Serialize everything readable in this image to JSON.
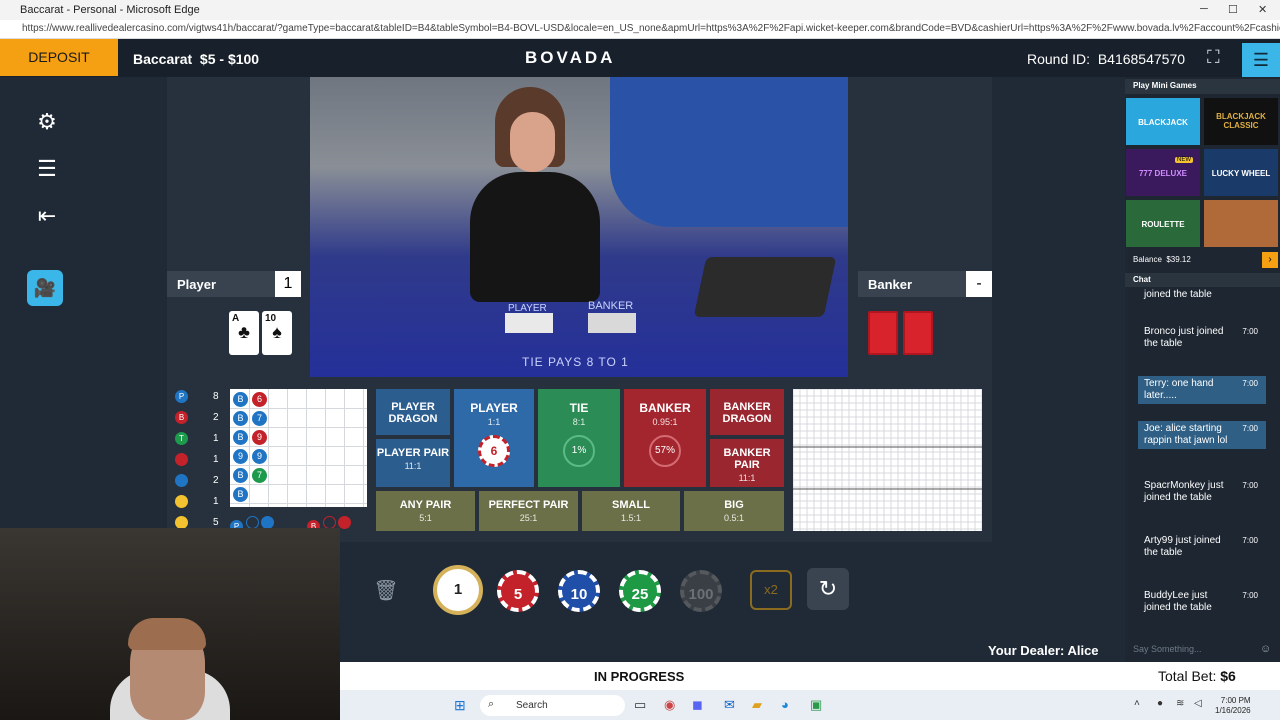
{
  "browser": {
    "title": "Baccarat - Personal - Microsoft Edge",
    "url": "https://www.reallivedealercasino.com/vigtws41h/baccarat/?gameType=baccarat&tableID=B4&tableSymbol=B4-BOVL-USD&locale=en_US_none&apmUrl=https%3A%2F%2Fapi.wicket-keeper.com&brandCode=BVD&cashierUrl=https%3A%2F%2Fwww.bovada.lv%2Faccount%2Fcashier%2Fdeposit&ho...",
    "min": "─",
    "max": "☐",
    "close": "✕"
  },
  "header": {
    "deposit": "DEPOSIT",
    "table_name": "Baccarat  $5 - $100",
    "brand": "BOVADA",
    "round_id": "Round ID:  B4168547570"
  },
  "sidebar": {
    "settings_icon": "⚙",
    "history_icon": "☰",
    "exit_icon": "⇤",
    "camera_icon": "🎥"
  },
  "hands": {
    "player_label": "Player",
    "player_score": "1",
    "banker_label": "Banker",
    "banker_score": "-",
    "player_cards": [
      {
        "rank": "A",
        "suit": "♣"
      },
      {
        "rank": "10",
        "suit": "♠"
      }
    ]
  },
  "video_overlay": {
    "player_word": "PLAYER",
    "banker_word": "BANKER",
    "tie_text": "TIE PAYS 8 TO 1"
  },
  "stats": [
    {
      "code": "P",
      "color": "#1f75c4",
      "count": "8"
    },
    {
      "code": "B",
      "color": "#c4222a",
      "count": "2"
    },
    {
      "code": "T",
      "color": "#1d9a4b",
      "count": "1"
    },
    {
      "code": "",
      "color": "#c4222a",
      "count": "1"
    },
    {
      "code": "",
      "color": "#1f75c4",
      "count": "2"
    },
    {
      "code": "",
      "color": "#f2c230",
      "count": "1"
    },
    {
      "code": "",
      "color": "#f2c230",
      "count": "5"
    }
  ],
  "bead_road": {
    "col1": [
      "B",
      "B",
      "B",
      "9",
      "B",
      "B"
    ],
    "col2": [
      "6",
      "7",
      "9",
      "9",
      "7"
    ]
  },
  "ask": {
    "p": "P",
    "b": "B"
  },
  "bets": {
    "player_dragon": "PLAYER DRAGON",
    "player_pair": "PLAYER PAIR",
    "player_pair_odds": "11:1",
    "player": "PLAYER",
    "player_odds": "1:1",
    "player_chip": "6",
    "tie": "TIE",
    "tie_odds": "8:1",
    "tie_pct": "1%",
    "banker": "BANKER",
    "banker_odds": "0.95:1",
    "banker_pct": "57%",
    "banker_dragon": "BANKER DRAGON",
    "banker_pair": "BANKER PAIR",
    "banker_pair_odds": "11:1",
    "any_pair": "ANY PAIR",
    "any_pair_odds": "5:1",
    "perfect_pair": "PERFECT PAIR",
    "perfect_pair_odds": "25:1",
    "small": "SMALL",
    "small_odds": "1.5:1",
    "big": "BIG",
    "big_odds": "0.5:1"
  },
  "chips": [
    "1",
    "5",
    "10",
    "25",
    "100"
  ],
  "controls": {
    "undo_icon": "🗑",
    "double": "x2",
    "repeat_icon": "↻"
  },
  "dealer": "Your Dealer: Alice",
  "status": "IN PROGRESS",
  "total_bet_label": "Total Bet:",
  "total_bet": "$6",
  "mini_games": {
    "title": "Play Mini Games",
    "games": [
      "BLACKJACK",
      "BLACKJACK CLASSIC",
      "777 DELUXE",
      "LUCKY WHEEL",
      "ROULETTE",
      ""
    ],
    "new_badge": "NEW",
    "balance": "Balance  $39.12"
  },
  "chat": {
    "title": "Chat",
    "messages": [
      {
        "text": "joined the table",
        "time": ""
      },
      {
        "text": "Bronco just joined the table",
        "time": "7:00"
      },
      {
        "text": "Terry: one hand later.....",
        "time": "7:00",
        "hl": true
      },
      {
        "text": "Joe: alice starting rappin that jawn lol",
        "time": "7:00",
        "hl": true
      },
      {
        "text": "SpacrMonkey just joined the table",
        "time": "7:00"
      },
      {
        "text": "Arty99 just joined the table",
        "time": "7:00"
      },
      {
        "text": "BuddyLee just joined the table",
        "time": "7:00"
      }
    ],
    "placeholder": "Say Something..."
  },
  "taskbar": {
    "search": "Search",
    "time": "7:00 PM",
    "date": "1/16/2026"
  }
}
